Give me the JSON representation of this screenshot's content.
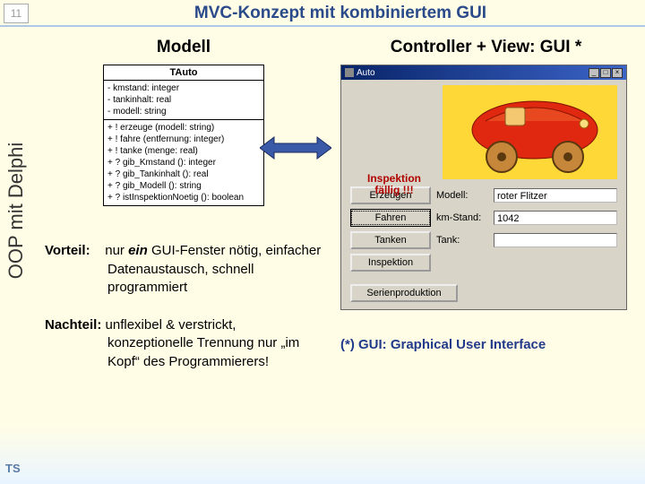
{
  "slide_number": "11",
  "title": "MVC-Konzept mit kombiniertem GUI",
  "sidebar_label": "OOP mit Delphi",
  "author_initials": "TS",
  "left": {
    "heading": "Modell",
    "uml": {
      "class_name": "TAuto",
      "attrs": [
        "- kmstand: integer",
        "- tankinhalt: real",
        "- modell: string"
      ],
      "ops": [
        "+ ! erzeuge (modell: string)",
        "+ ! fahre (entfernung: integer)",
        "+ ! tanke (menge: real)",
        "+ ? gib_Kmstand (): integer",
        "+ ? gib_Tankinhalt (): real",
        "+ ? gib_Modell (): string",
        "+ ? istInspektionNoetig (): boolean"
      ]
    },
    "vorteil_label": "Vorteil:",
    "vorteil_text_1": "nur",
    "vorteil_text_em": "ein",
    "vorteil_text_2": " GUI-Fenster nötig, einfacher Datenaustausch, schnell programmiert",
    "nachteil_label": "Nachteil:",
    "nachteil_text": "unflexibel & verstrickt, konzeptionelle Trennung nur „im Kopf“ des Programmierers!"
  },
  "right": {
    "heading": "Controller + View: GUI  *",
    "window_title": "Auto",
    "inspection_warning_l1": "Inspektion",
    "inspection_warning_l2": "fällig !!!",
    "controls": {
      "erzeugen": "Erzeugen",
      "modell_label": "Modell:",
      "modell_value": "roter Flitzer",
      "fahren": "Fahren",
      "km_label": "km-Stand:",
      "km_value": "1042",
      "tanken": "Tanken",
      "tank_label": "Tank:",
      "tank_value": "",
      "inspektion": "Inspektion",
      "serienprod": "Serienproduktion"
    },
    "footnote": "(*) GUI: Graphical User Interface"
  }
}
